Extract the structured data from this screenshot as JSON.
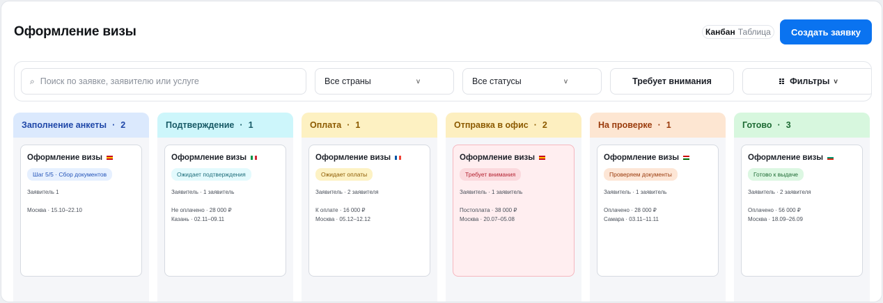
{
  "header": {
    "title": "Оформление визы",
    "view_toggle": [
      "Канбан",
      "Таблица"
    ],
    "active_view": "Канбан",
    "create_button": "Создать заявку"
  },
  "toolbar": {
    "search_placeholder": "Поиск по заявке, заявителю или услуге",
    "country_select": "Все страны",
    "status_select": "Все статусы",
    "attention_button": "Требует внимания",
    "filters_button": "Фильтры",
    "chevron": "v"
  },
  "colors": {
    "accent": "#0a73f0"
  },
  "columns": [
    {
      "title": "Заполнение анкеты",
      "count": "2",
      "head_bg": "#dbe9fd",
      "head_color": "#1f47a8",
      "card": {
        "title": "Оформление визы",
        "flag": "spain",
        "badge": "Шаг 5/5 · Сбор документов",
        "badge_bg": "#e6f0ff",
        "badge_color": "#2454b8",
        "applicants": "Заявитель 1",
        "lines": [
          "Москва · 15.10–22.10"
        ]
      }
    },
    {
      "title": "Подтверждение",
      "count": "1",
      "head_bg": "#cdf6fb",
      "head_color": "#175a66",
      "card": {
        "title": "Оформление визы",
        "flag": "italy",
        "badge": "Ожидает подтверждения",
        "badge_bg": "#e3fafd",
        "badge_color": "#1c6d7a",
        "applicants": "Заявитель · 1 заявитель",
        "lines": [
          "Не оплачено · 28 000 ₽",
          "Казань · 02.11–09.11"
        ]
      }
    },
    {
      "title": "Оплата",
      "count": "1",
      "head_bg": "#fdf1c2",
      "head_color": "#8c5a00",
      "card": {
        "title": "Оформление визы",
        "flag": "france",
        "badge": "Ожидает оплаты",
        "badge_bg": "#fdf2c4",
        "badge_color": "#8c5a00",
        "applicants": "Заявитель · 2 заявителя",
        "lines": [
          "К оплате · 16 000 ₽",
          "Москва · 05.12–12.12"
        ]
      }
    },
    {
      "title": "Отправка в офис",
      "count": "2",
      "head_bg": "#fdefc0",
      "head_color": "#8c5a00",
      "card": {
        "title": "Оформление визы",
        "flag": "spain",
        "alert": true,
        "badge": "Требует внимания",
        "badge_bg": "#fbd9dd",
        "badge_color": "#b42332",
        "applicants": "Заявитель · 1 заявитель",
        "lines": [
          "Постоплата · 38 000 ₽",
          "Москва · 20.07–05.08"
        ]
      }
    },
    {
      "title": "На проверке",
      "count": "1",
      "head_bg": "#fde6d2",
      "head_color": "#9a3b0c",
      "card": {
        "title": "Оформление визы",
        "flag": "tajikistan",
        "badge": "Проверяем документы",
        "badge_bg": "#fde6d6",
        "badge_color": "#9a3b0c",
        "applicants": "Заявитель · 1 заявитель",
        "lines": [
          "Оплачено · 28 000 ₽",
          "Самара · 03.11–11.11"
        ]
      }
    },
    {
      "title": "Готово",
      "count": "3",
      "head_bg": "#d7f7de",
      "head_color": "#1e6b34",
      "card": {
        "title": "Оформление визы",
        "flag": "bulgaria",
        "badge": "Готово к выдаче",
        "badge_bg": "#dcf7e2",
        "badge_color": "#1e6b34",
        "applicants": "Заявитель · 2 заявителя",
        "lines": [
          "Оплачено · 56 000 ₽",
          "Москва · 18.09–26.09"
        ]
      }
    }
  ]
}
